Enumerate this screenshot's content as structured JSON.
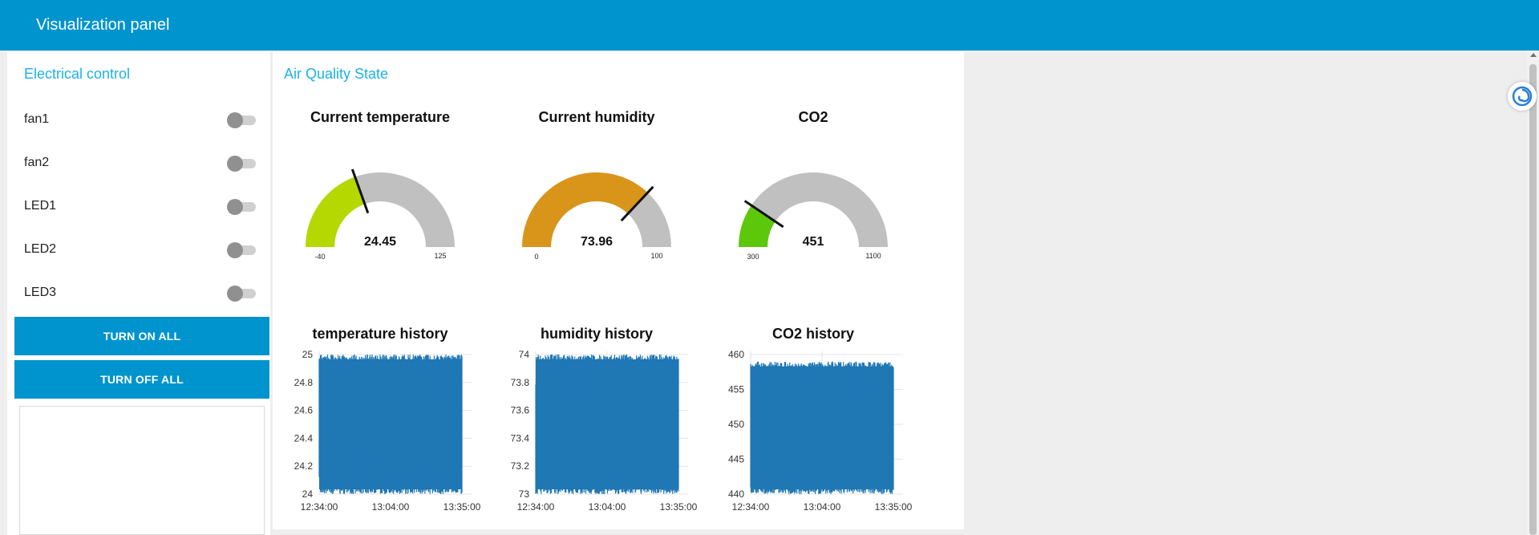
{
  "header": {
    "title": "Visualization panel"
  },
  "controls": {
    "title": "Electrical control",
    "switches": [
      {
        "label": "fan1",
        "on": false
      },
      {
        "label": "fan2",
        "on": false
      },
      {
        "label": "LED1",
        "on": false
      },
      {
        "label": "LED2",
        "on": false
      },
      {
        "label": "LED3",
        "on": false
      }
    ],
    "turn_on_all": "TURN ON ALL",
    "turn_off_all": "TURN OFF ALL"
  },
  "air": {
    "title": "Air Quality State",
    "gauges": [
      {
        "title": "Current temperature",
        "value": "24.45",
        "num": 24.45,
        "min": "-40",
        "max": "125",
        "minNum": -40,
        "maxNum": 125,
        "color": "#b5d900"
      },
      {
        "title": "Current humidity",
        "value": "73.96",
        "num": 73.96,
        "min": "0",
        "max": "100",
        "minNum": 0,
        "maxNum": 100,
        "color": "#d9951a"
      },
      {
        "title": "CO2",
        "value": "451",
        "num": 451,
        "min": "300",
        "max": "1100",
        "minNum": 300,
        "maxNum": 1100,
        "color": "#5cc80c"
      }
    ],
    "charts": [
      {
        "title": "temperature history",
        "yticks": [
          "25",
          "24.8",
          "24.6",
          "24.4",
          "24.2",
          "24"
        ],
        "xticks": [
          "12:34:00",
          "13:04:00",
          "13:35:00"
        ]
      },
      {
        "title": "humidity history",
        "yticks": [
          "74",
          "73.8",
          "73.6",
          "73.4",
          "73.2",
          "73"
        ],
        "xticks": [
          "12:34:00",
          "13:04:00",
          "13:35:00"
        ]
      },
      {
        "title": "CO2 history",
        "yticks": [
          "460",
          "455",
          "450",
          "445",
          "440"
        ],
        "xticks": [
          "12:34:00",
          "13:04:00",
          "13:35:00"
        ]
      }
    ]
  },
  "chart_data": [
    {
      "type": "area",
      "title": "temperature history",
      "x": [
        "12:34:00",
        "13:04:00",
        "13:35:00"
      ],
      "ylim": [
        24,
        25
      ],
      "series": [
        {
          "values": [
            24.0,
            25.0
          ]
        }
      ]
    },
    {
      "type": "area",
      "title": "humidity history",
      "x": [
        "12:34:00",
        "13:04:00",
        "13:35:00"
      ],
      "ylim": [
        73,
        74
      ],
      "series": [
        {
          "values": [
            73.0,
            74.0
          ]
        }
      ]
    },
    {
      "type": "area",
      "title": "CO2 history",
      "x": [
        "12:34:00",
        "13:04:00",
        "13:35:00"
      ],
      "ylim": [
        440,
        460
      ],
      "series": [
        {
          "values": [
            440,
            459
          ]
        }
      ]
    }
  ],
  "colors": {
    "header": "#0094ce",
    "accent": "#1ab3e6",
    "series": "#1f77b4",
    "gauge_bg": "#c0c0c0"
  },
  "icons": {
    "extension": "swirl-icon"
  }
}
